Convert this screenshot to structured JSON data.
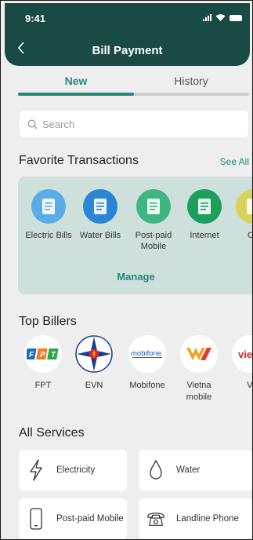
{
  "status": {
    "time": "9:41"
  },
  "header": {
    "title": "Bill Payment"
  },
  "tabs": [
    {
      "label": "New"
    },
    {
      "label": "History"
    }
  ],
  "search": {
    "placeholder": "Search"
  },
  "favorites": {
    "title": "Favorite Transactions",
    "see_all": "See All",
    "manage": "Manage",
    "items": [
      {
        "label": "Electric Bills",
        "color": "#5aace6",
        "icon": "document-icon"
      },
      {
        "label": "Water Bills",
        "color": "#2a86d4",
        "icon": "document-icon"
      },
      {
        "label": "Post-paid Mobile",
        "color": "#3fb583",
        "icon": "document-icon"
      },
      {
        "label": "Internet",
        "color": "#1c9e5e",
        "icon": "document-icon"
      },
      {
        "label": "Co",
        "color": "#d7d35a",
        "icon": "document-icon"
      }
    ]
  },
  "top_billers": {
    "title": "Top Billers",
    "items": [
      {
        "label": "FPT",
        "logo_text": "FPT"
      },
      {
        "label": "EVN",
        "logo_text": ""
      },
      {
        "label": "Mobifone",
        "logo_text": "mobifone"
      },
      {
        "label": "Vietna mobile",
        "logo_text": ""
      },
      {
        "label": "Vi",
        "logo_text": "vie"
      }
    ]
  },
  "all_services": {
    "title": "All Services",
    "items": [
      {
        "label": "Electricity",
        "icon": "lightning-icon"
      },
      {
        "label": "Water",
        "icon": "water-drop-icon"
      },
      {
        "label": "Post-paid Mobile",
        "icon": "mobile-phone-icon"
      },
      {
        "label": "Landline Phone",
        "icon": "landline-phone-icon"
      }
    ]
  },
  "colors": {
    "header": "#1a4a44",
    "accent": "#1f8a77",
    "card": "#cde0dc"
  }
}
